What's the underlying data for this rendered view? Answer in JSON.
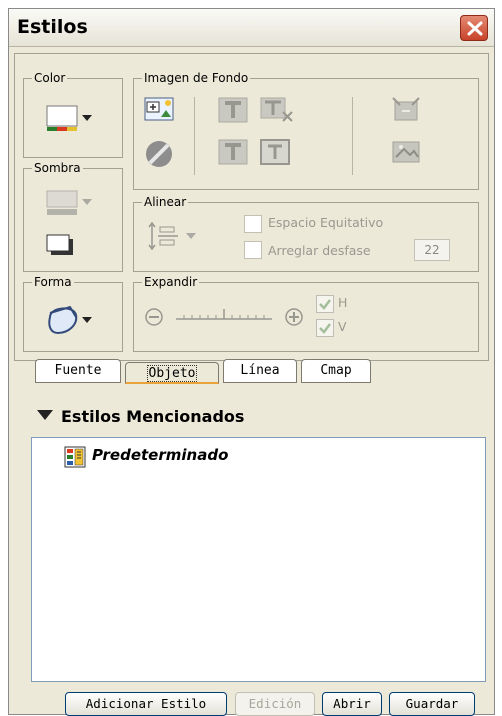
{
  "window": {
    "title": "Estilos"
  },
  "groups": {
    "color": "Color",
    "sombra": "Sombra",
    "forma": "Forma",
    "imagen": "Imagen de Fondo",
    "alinear": "Alinear",
    "expandir": "Expandir"
  },
  "alinear": {
    "espacio_label": "Espacio Equitativo",
    "arreglar_label": "Arreglar desfase",
    "desfase_value": "22"
  },
  "expandir": {
    "h_label": "H",
    "v_label": "V"
  },
  "tabs": [
    {
      "label": "Fuente",
      "active": false
    },
    {
      "label": "Objeto",
      "active": true
    },
    {
      "label": "Línea",
      "active": false
    },
    {
      "label": "Cmap",
      "active": false
    }
  ],
  "estilos": {
    "heading": "Estilos Mencionados",
    "items": [
      {
        "label": "Predeterminado"
      }
    ]
  },
  "buttons": {
    "adicionar": "Adicionar Estilo",
    "edicion": "Edición",
    "abrir": "Abrir",
    "guardar": "Guardar"
  },
  "colors": {
    "accent_tab": "#e8a33a",
    "close": "#c8432a",
    "panel_bg": "#ece9d8"
  }
}
